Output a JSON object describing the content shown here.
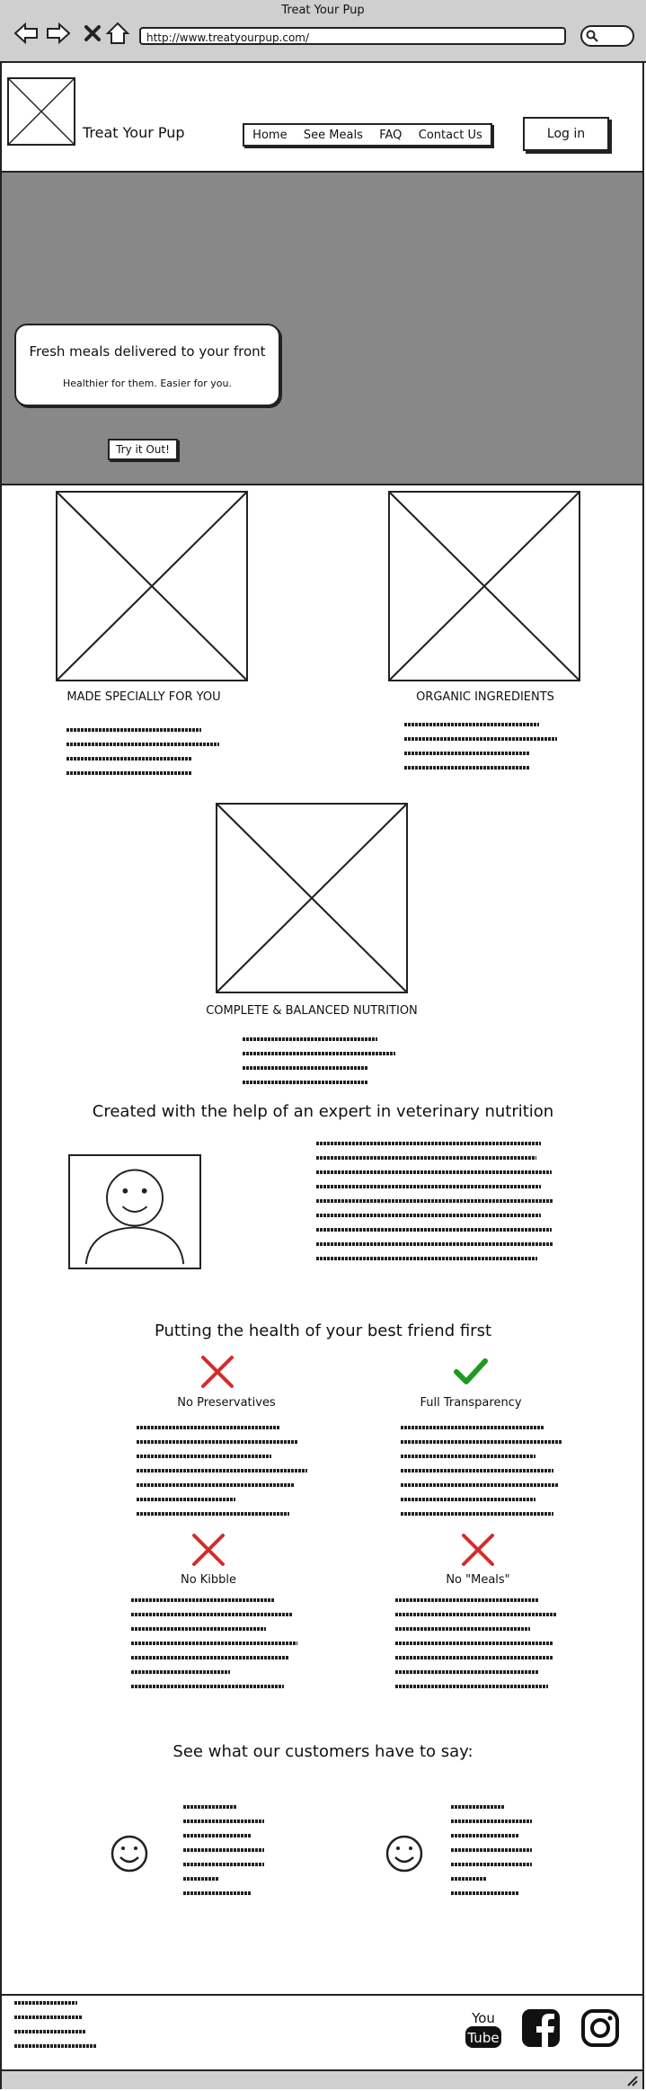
{
  "browser": {
    "window_title": "Treat Your Pup",
    "address": "http://www.treatyourpup.com/"
  },
  "header": {
    "brand": "Treat Your Pup",
    "nav": [
      "Home",
      "See Meals",
      "FAQ",
      "Contact Us"
    ],
    "login_label": "Log in"
  },
  "hero": {
    "heading": "Fresh meals delivered to your front",
    "subheading": "Healthier for them. Easier for you.",
    "cta_label": "Try it Out!"
  },
  "features": {
    "made_specially": "MADE SPECIALLY FOR YOU",
    "organic": "ORGANIC INGREDIENTS",
    "nutrition": "COMPLETE & BALANCED NUTRITION"
  },
  "expert": {
    "title": "Created with the help of an expert in veterinary nutrition"
  },
  "health": {
    "title": "Putting the health of your best friend first",
    "items": [
      {
        "label": "No Preservatives",
        "icon": "x-icon"
      },
      {
        "label": "Full Transparency",
        "icon": "check-icon"
      },
      {
        "label": "No Kibble",
        "icon": "x-icon"
      },
      {
        "label": "No \"Meals\"",
        "icon": "x-icon"
      }
    ],
    "colors": {
      "x": "#d62b2b",
      "check": "#1f9a1f"
    }
  },
  "testimonials": {
    "title": "See what our customers have to say:"
  },
  "footer": {
    "social_icons": [
      "youtube-icon",
      "facebook-icon",
      "instagram-icon"
    ]
  },
  "theme": {
    "hero_bg": "#888888",
    "chrome_bg": "#cfcfcf"
  }
}
